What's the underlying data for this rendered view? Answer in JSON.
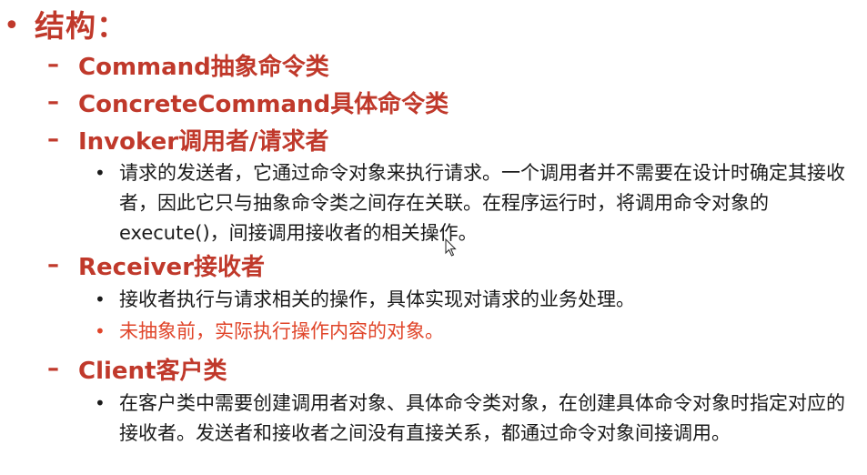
{
  "title": {
    "bullet": "•",
    "text": "结构："
  },
  "sections": [
    {
      "dash": "–",
      "label": "Command抽象命令类"
    },
    {
      "dash": "–",
      "label": "ConcreteCommand具体命令类"
    },
    {
      "dash": "–",
      "label": "Invoker调用者/请求者"
    },
    {
      "dash": "–",
      "label": "Receiver接收者"
    },
    {
      "dash": "–",
      "label": "Client客户类"
    }
  ],
  "details": {
    "invoker": [
      {
        "bullet": "•",
        "text": "请求的发送者，它通过命令对象来执行请求。一个调用者并不需要在设计时确定其接收者，因此它只与抽象命令类之间存在关联。在程序运行时，将调用命令对象的execute()，间接调用接收者的相关操作。"
      }
    ],
    "receiver": [
      {
        "bullet": "•",
        "text": "接收者执行与请求相关的操作，具体实现对请求的业务处理。"
      },
      {
        "bullet": "•",
        "text": "未抽象前，实际执行操作内容的对象。"
      }
    ],
    "client": [
      {
        "bullet": "•",
        "text": "在客户类中需要创建调用者对象、具体命令类对象，在创建具体命令对象时指定对应的接收者。发送者和接收者之间没有直接关系，都通过命令对象间接调用。"
      }
    ]
  },
  "colors": {
    "heading": "#c0392b",
    "highlight": "#e0452a",
    "body": "#1a1a1a"
  },
  "icons": {
    "cursor": "mouse-cursor-icon"
  }
}
